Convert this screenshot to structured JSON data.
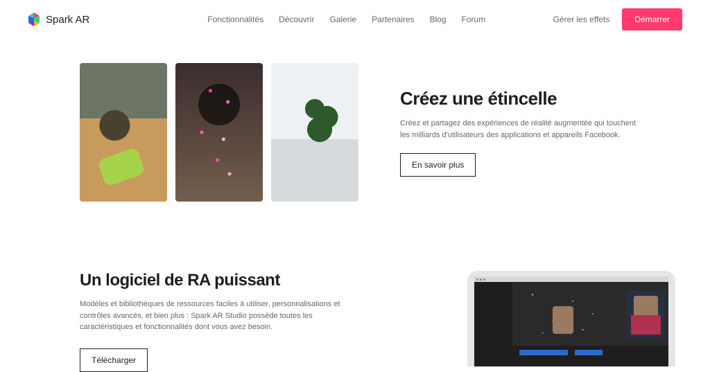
{
  "brand": {
    "name": "Spark AR"
  },
  "nav": {
    "items": [
      {
        "label": "Fonctionnalités"
      },
      {
        "label": "Découvrir"
      },
      {
        "label": "Galerie"
      },
      {
        "label": "Partenaires"
      },
      {
        "label": "Blog"
      },
      {
        "label": "Forum"
      }
    ],
    "manage": "Gérer les effets",
    "cta": "Démarrer"
  },
  "hero": {
    "title": "Créez une étincelle",
    "desc": "Créez et partagez des expériences de réalité augmentée qui touchent les milliards d'utilisateurs des applications et appareils Facebook.",
    "button": "En savoir plus"
  },
  "section2": {
    "title": "Un logiciel de RA puissant",
    "desc": "Modèles et bibliothèques de ressources faciles à utiliser, personnalisations et contrôles avancés, et bien plus : Spark AR Studio possède toutes les caractéristiques et fonctionnalités dont vous avez besoin.",
    "button": "Télécharger"
  }
}
